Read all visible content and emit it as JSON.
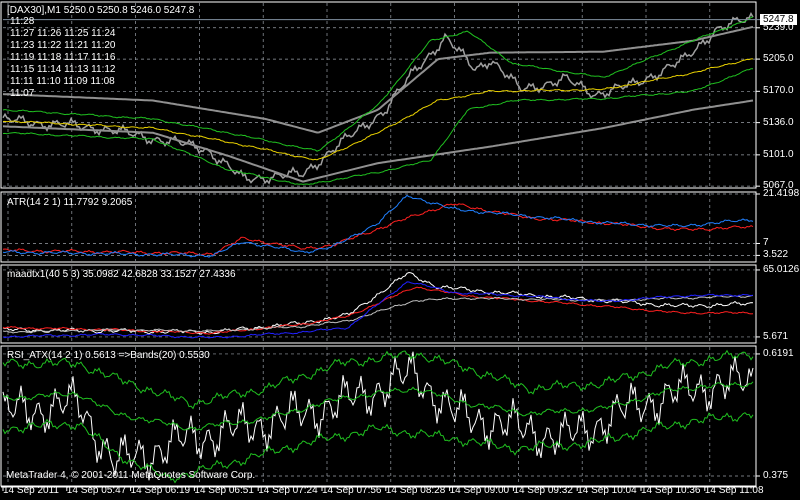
{
  "chart_data": [
    {
      "type": "line",
      "panel": "main",
      "title": "[DAX30],M1  5250.0 5250.8 5246.0 5247.8",
      "current_price": "5247.8",
      "yticks": [
        "5239.0",
        "5205.0",
        "5170.0",
        "5136.0",
        "5101.0",
        "5067.0"
      ],
      "ylim": [
        5065,
        5267
      ],
      "time_list": [
        "11:28",
        "11:27 11:26 11:25 11:24",
        "11:23 11:22 11:21 11:20",
        "11:19 11:18 11:17 11:16",
        "11:15 11:14 11:13 11:12",
        "11:11 11:10 11:09 11:08",
        "11:07"
      ],
      "series": [
        {
          "name": "price",
          "color": "#a0a0a0",
          "width": 1.5,
          "noise": 6,
          "points": [
            [
              0,
              5139
            ],
            [
              13,
              5130
            ],
            [
              27,
              5108
            ],
            [
              32,
              5075
            ],
            [
              40,
              5080
            ],
            [
              44,
              5107
            ],
            [
              51,
              5150
            ],
            [
              55,
              5194
            ],
            [
              59,
              5228
            ],
            [
              63,
              5194
            ],
            [
              65,
              5205
            ],
            [
              69,
              5172
            ],
            [
              75,
              5183
            ],
            [
              79,
              5167
            ],
            [
              84,
              5177
            ],
            [
              91,
              5205
            ],
            [
              95,
              5237
            ],
            [
              100,
              5250
            ]
          ]
        },
        {
          "name": "gray-upper",
          "color": "#909090",
          "width": 2,
          "noise": 0,
          "points": [
            [
              0,
              5167
            ],
            [
              20,
              5160
            ],
            [
              35,
              5140
            ],
            [
              42,
              5125
            ],
            [
              50,
              5150
            ],
            [
              58,
              5205
            ],
            [
              65,
              5212
            ],
            [
              80,
              5213
            ],
            [
              92,
              5225
            ],
            [
              100,
              5240
            ]
          ]
        },
        {
          "name": "gray-lower",
          "color": "#909090",
          "width": 2,
          "noise": 0,
          "points": [
            [
              0,
              5132
            ],
            [
              20,
              5125
            ],
            [
              30,
              5100
            ],
            [
              40,
              5072
            ],
            [
              50,
              5092
            ],
            [
              65,
              5110
            ],
            [
              80,
              5130
            ],
            [
              92,
              5150
            ],
            [
              100,
              5160
            ]
          ]
        },
        {
          "name": "yellow-ma",
          "color": "#e8d000",
          "width": 1,
          "noise": 1,
          "points": [
            [
              0,
              5138
            ],
            [
              20,
              5130
            ],
            [
              30,
              5115
            ],
            [
              42,
              5095
            ],
            [
              50,
              5125
            ],
            [
              58,
              5160
            ],
            [
              65,
              5170
            ],
            [
              80,
              5172
            ],
            [
              92,
              5190
            ],
            [
              100,
              5206
            ]
          ]
        },
        {
          "name": "green-upper",
          "color": "#20c020",
          "width": 1,
          "noise": 1,
          "points": [
            [
              0,
              5150
            ],
            [
              20,
              5140
            ],
            [
              30,
              5125
            ],
            [
              42,
              5105
            ],
            [
              50,
              5155
            ],
            [
              57,
              5225
            ],
            [
              62,
              5235
            ],
            [
              68,
              5200
            ],
            [
              80,
              5185
            ],
            [
              92,
              5225
            ],
            [
              100,
              5250
            ]
          ]
        },
        {
          "name": "green-lower",
          "color": "#20c020",
          "width": 1,
          "noise": 1,
          "points": [
            [
              0,
              5125
            ],
            [
              20,
              5118
            ],
            [
              30,
              5085
            ],
            [
              40,
              5068
            ],
            [
              50,
              5082
            ],
            [
              57,
              5095
            ],
            [
              62,
              5150
            ],
            [
              68,
              5160
            ],
            [
              80,
              5162
            ],
            [
              92,
              5170
            ],
            [
              100,
              5195
            ]
          ]
        }
      ]
    },
    {
      "type": "line",
      "panel": "atr",
      "title": "ATR(14 2 1) 11.7792 9.2065",
      "yticks": [
        "21.4198",
        "7",
        "3.522"
      ],
      "ylim": [
        1.6,
        22.0
      ],
      "series": [
        {
          "name": "atr-red",
          "color": "#ff2020",
          "width": 1,
          "noise": 0.5,
          "points": [
            [
              0,
              5.0
            ],
            [
              15,
              4.5
            ],
            [
              28,
              4.0
            ],
            [
              32,
              8.5
            ],
            [
              40,
              5.5
            ],
            [
              44,
              6.5
            ],
            [
              56,
              16
            ],
            [
              60,
              18.5
            ],
            [
              70,
              14.5
            ],
            [
              80,
              13
            ],
            [
              90,
              11
            ],
            [
              100,
              11.8
            ]
          ]
        },
        {
          "name": "atr-blue",
          "color": "#2080ff",
          "width": 1,
          "noise": 0.5,
          "points": [
            [
              0,
              4.5
            ],
            [
              15,
              4.0
            ],
            [
              28,
              3.5
            ],
            [
              32,
              7.5
            ],
            [
              40,
              4.5
            ],
            [
              44,
              6
            ],
            [
              50,
              13
            ],
            [
              54,
              21
            ],
            [
              60,
              17
            ],
            [
              70,
              15
            ],
            [
              80,
              13
            ],
            [
              90,
              12
            ],
            [
              100,
              14
            ]
          ]
        }
      ]
    },
    {
      "type": "line",
      "panel": "maadtx",
      "title": "maadtx1(40 5 3) 35.0982 42.6828 33.1527 27.4336",
      "yticks": [
        "65.0126",
        "5.671"
      ],
      "ylim": [
        0.3,
        69.4
      ],
      "series": [
        {
          "name": "adx-white",
          "color": "#ffffff",
          "width": 1,
          "noise": 2,
          "points": [
            [
              0,
              12
            ],
            [
              15,
              11
            ],
            [
              28,
              10
            ],
            [
              40,
              18
            ],
            [
              46,
              25
            ],
            [
              54,
              62
            ],
            [
              58,
              50
            ],
            [
              66,
              45
            ],
            [
              80,
              38
            ],
            [
              90,
              33
            ],
            [
              100,
              35
            ]
          ]
        },
        {
          "name": "adx-red",
          "color": "#ff2020",
          "width": 1,
          "noise": 1,
          "points": [
            [
              0,
              14
            ],
            [
              15,
              12
            ],
            [
              28,
              9
            ],
            [
              40,
              17
            ],
            [
              46,
              24
            ],
            [
              55,
              50
            ],
            [
              62,
              42
            ],
            [
              80,
              33
            ],
            [
              90,
              27
            ],
            [
              100,
              27
            ]
          ]
        },
        {
          "name": "adx-gray",
          "color": "#c0c0c0",
          "width": 1,
          "noise": 1,
          "points": [
            [
              0,
              10
            ],
            [
              15,
              12
            ],
            [
              28,
              11
            ],
            [
              40,
              15
            ],
            [
              46,
              20
            ],
            [
              55,
              38
            ],
            [
              62,
              40
            ],
            [
              80,
              38
            ],
            [
              90,
              40
            ],
            [
              100,
              42
            ]
          ]
        },
        {
          "name": "adx-blue",
          "color": "#2020ff",
          "width": 1,
          "noise": 1,
          "points": [
            [
              0,
              6
            ],
            [
              15,
              8
            ],
            [
              28,
              5
            ],
            [
              40,
              10
            ],
            [
              46,
              14
            ],
            [
              54,
              55
            ],
            [
              60,
              45
            ],
            [
              70,
              42
            ],
            [
              80,
              37
            ],
            [
              90,
              42
            ],
            [
              100,
              43
            ]
          ]
        }
      ]
    },
    {
      "type": "line",
      "panel": "rsi",
      "title": "RSI_ATX(14 2 1) 0.5613  =>Bands(20) 0.5530",
      "yticks": [
        "0.6191",
        "0.375"
      ],
      "ylim": [
        0.355,
        0.635
      ],
      "series": [
        {
          "name": "rsi-white",
          "color": "#ffffff",
          "width": 1,
          "noise": 0.045,
          "points": [
            [
              0,
              0.5
            ],
            [
              10,
              0.52
            ],
            [
              15,
              0.4
            ],
            [
              25,
              0.45
            ],
            [
              35,
              0.48
            ],
            [
              45,
              0.52
            ],
            [
              55,
              0.58
            ],
            [
              60,
              0.5
            ],
            [
              66,
              0.48
            ],
            [
              75,
              0.45
            ],
            [
              85,
              0.52
            ],
            [
              95,
              0.56
            ],
            [
              100,
              0.56
            ]
          ]
        },
        {
          "name": "rsi-band-up",
          "color": "#20c020",
          "width": 1,
          "noise": 0.01,
          "points": [
            [
              0,
              0.6
            ],
            [
              10,
              0.6
            ],
            [
              15,
              0.57
            ],
            [
              25,
              0.52
            ],
            [
              35,
              0.55
            ],
            [
              45,
              0.6
            ],
            [
              55,
              0.62
            ],
            [
              62,
              0.59
            ],
            [
              70,
              0.55
            ],
            [
              80,
              0.56
            ],
            [
              90,
              0.6
            ],
            [
              100,
              0.62
            ]
          ]
        },
        {
          "name": "rsi-band-mid",
          "color": "#20c020",
          "width": 1,
          "noise": 0.006,
          "points": [
            [
              0,
              0.53
            ],
            [
              10,
              0.54
            ],
            [
              15,
              0.5
            ],
            [
              25,
              0.47
            ],
            [
              35,
              0.49
            ],
            [
              45,
              0.53
            ],
            [
              55,
              0.55
            ],
            [
              62,
              0.52
            ],
            [
              70,
              0.5
            ],
            [
              80,
              0.51
            ],
            [
              90,
              0.55
            ],
            [
              100,
              0.56
            ]
          ]
        },
        {
          "name": "rsi-band-low",
          "color": "#20c020",
          "width": 1,
          "noise": 0.01,
          "points": [
            [
              0,
              0.47
            ],
            [
              10,
              0.48
            ],
            [
              15,
              0.42
            ],
            [
              22,
              0.37
            ],
            [
              30,
              0.4
            ],
            [
              40,
              0.44
            ],
            [
              50,
              0.47
            ],
            [
              60,
              0.45
            ],
            [
              68,
              0.43
            ],
            [
              78,
              0.44
            ],
            [
              90,
              0.48
            ],
            [
              100,
              0.5
            ]
          ]
        }
      ]
    }
  ],
  "time_labels": [
    "14 Sep 2011",
    "14 Sep 05:47",
    "14 Sep 06:19",
    "14 Sep 06:51",
    "14 Sep 07:24",
    "14 Sep 07:56",
    "14 Sep 08:28",
    "14 Sep 09:00",
    "14 Sep 09:32",
    "14 Sep 10:04",
    "14 Sep 10:36",
    "14 Sep 11:08"
  ],
  "copyright": "MetaTrader 4, © 2001-2011 MetaQuotes Software Corp."
}
